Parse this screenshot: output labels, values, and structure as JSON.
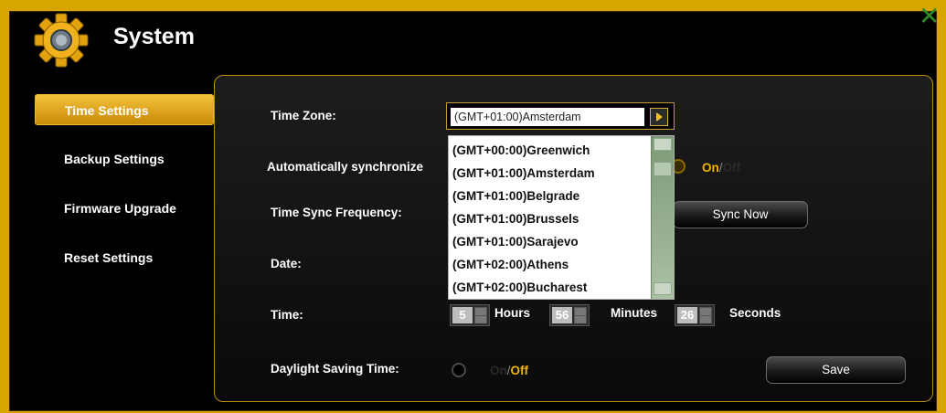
{
  "window": {
    "title": "System",
    "close_icon": "close-icon",
    "gear_icon": "gear-icon"
  },
  "sidebar": {
    "items": [
      {
        "label": "Time Settings",
        "active": true
      },
      {
        "label": "Backup Settings",
        "active": false
      },
      {
        "label": "Firmware Upgrade",
        "active": false
      },
      {
        "label": "Reset Settings",
        "active": false
      }
    ]
  },
  "form": {
    "time_zone_label": "Time Zone:",
    "time_zone_value": "(GMT+01:00)Amsterdam",
    "auto_sync_label": "Automatically synchronize",
    "auto_sync_on": "On",
    "auto_sync_slash": "/",
    "auto_sync_off": "Off",
    "sync_freq_label": "Time Sync Frequency:",
    "sync_now_label": "Sync Now",
    "date_label": "Date:",
    "time_label": "Time:",
    "hours_value": "5",
    "hours_unit": "Hours",
    "minutes_value": "56",
    "minutes_unit": "Minutes",
    "seconds_value": "26",
    "seconds_unit": "Seconds",
    "dst_label": "Daylight Saving Time:",
    "dst_on": "On",
    "dst_slash": "/",
    "dst_off": "Off",
    "save_label": "Save"
  },
  "timezone_dropdown": {
    "options": [
      "(GMT+00:00)Greenwich",
      "(GMT+01:00)Amsterdam",
      "(GMT+01:00)Belgrade",
      "(GMT+01:00)Brussels",
      "(GMT+01:00)Sarajevo",
      "(GMT+02:00)Athens",
      "(GMT+02:00)Bucharest"
    ]
  },
  "colors": {
    "accent": "#f0b400",
    "frame": "#d8a500",
    "close": "#2f8a2a"
  }
}
